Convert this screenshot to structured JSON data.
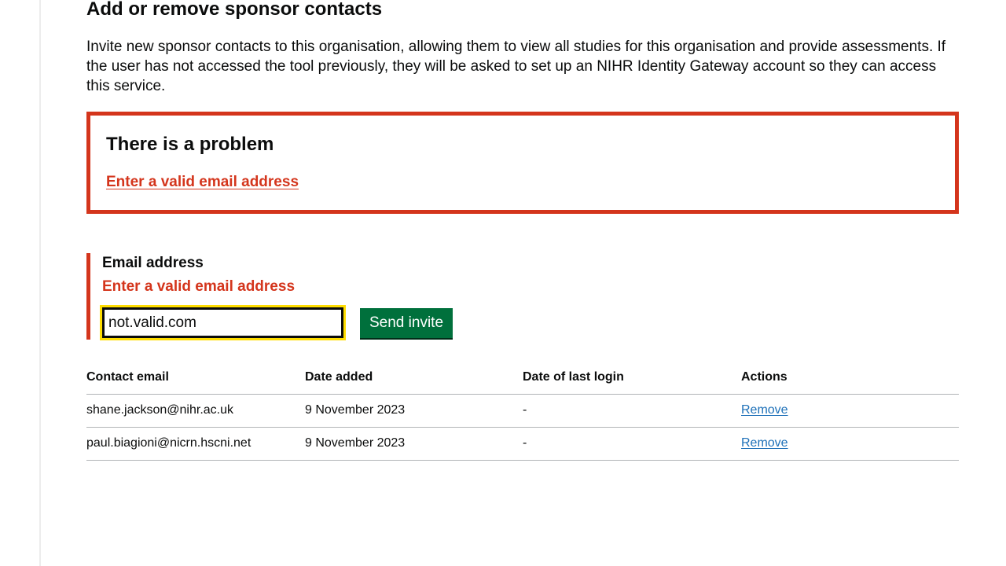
{
  "page": {
    "title": "Add or remove sponsor contacts",
    "intro": "Invite new sponsor contacts to this organisation, allowing them to view all studies for this organisation and provide assessments. If the user has not accessed the tool previously, they will be asked to set up an NIHR Identity Gateway account so they can access this service."
  },
  "error_summary": {
    "title": "There is a problem",
    "link_text": "Enter a valid email address"
  },
  "form": {
    "label": "Email address",
    "error": "Enter a valid email address",
    "value": "not.valid.com",
    "submit_label": "Send invite"
  },
  "table": {
    "headers": [
      "Contact email",
      "Date added",
      "Date of last login",
      "Actions"
    ],
    "rows": [
      {
        "email": "shane.jackson@nihr.ac.uk",
        "date_added": "9 November 2023",
        "last_login": "-",
        "action": "Remove"
      },
      {
        "email": "paul.biagioni@nicrn.hscni.net",
        "date_added": "9 November 2023",
        "last_login": "-",
        "action": "Remove"
      }
    ]
  },
  "colors": {
    "error": "#d4351c",
    "button": "#00703c",
    "focus": "#ffdd00",
    "link": "#1d70b8"
  }
}
